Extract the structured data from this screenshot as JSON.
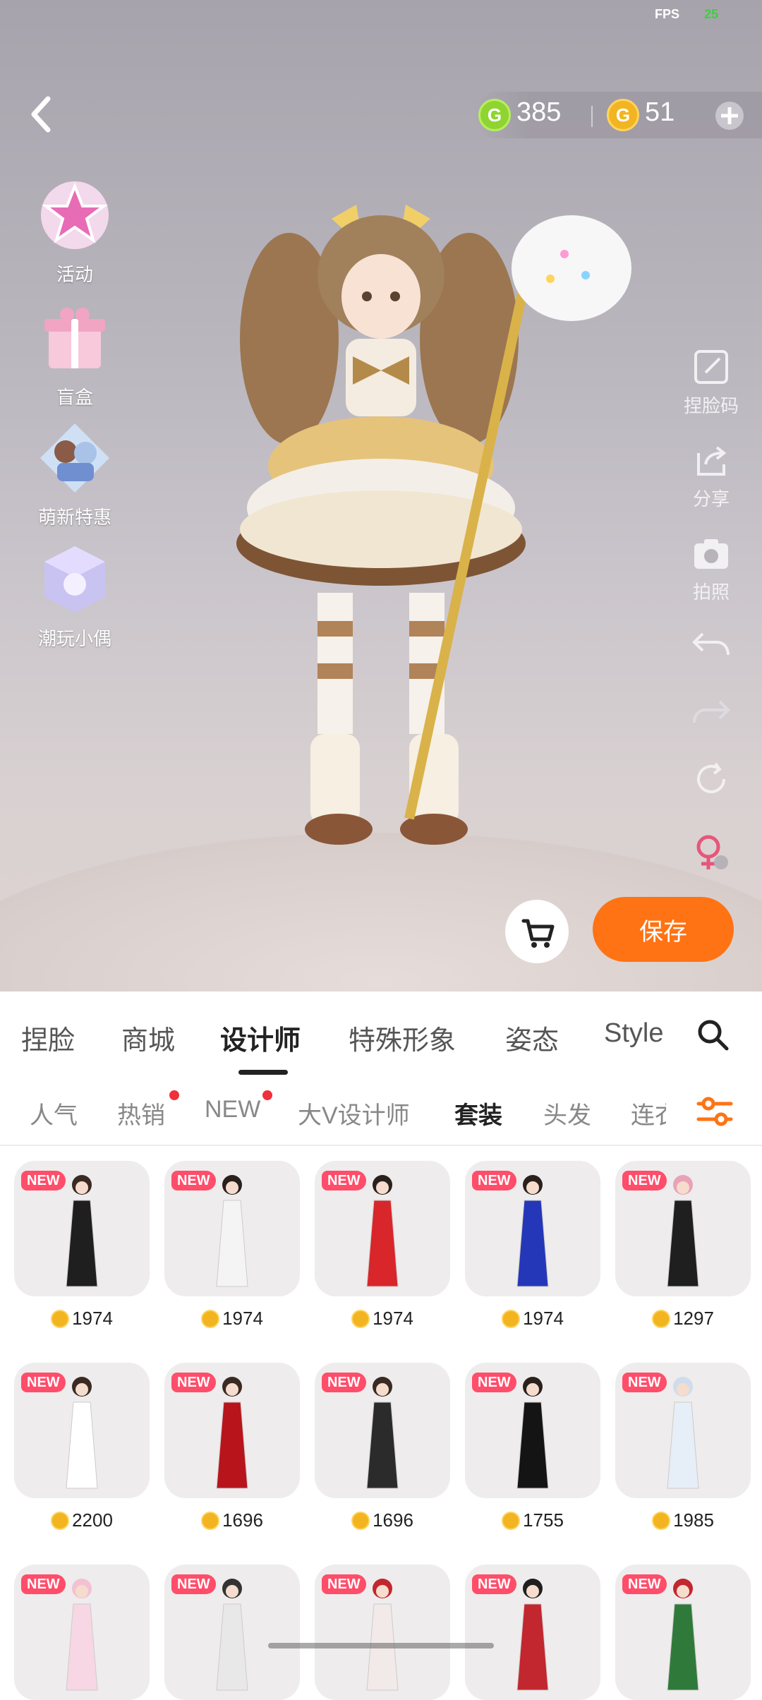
{
  "status": {
    "fps_label": "FPS",
    "fps_value": "25"
  },
  "currency": {
    "green": "385",
    "gold": "51"
  },
  "left_menu": [
    {
      "label": "活动",
      "icon": "star-badge-icon"
    },
    {
      "label": "盲盒",
      "icon": "gift-box-icon"
    },
    {
      "label": "萌新特惠",
      "icon": "character-pack-icon"
    },
    {
      "label": "潮玩小偶",
      "icon": "toy-cube-icon"
    }
  ],
  "right_tools": [
    {
      "label": "捏脸码",
      "icon": "face-code-icon"
    },
    {
      "label": "分享",
      "icon": "share-icon"
    },
    {
      "label": "拍照",
      "icon": "camera-icon"
    },
    {
      "label": "",
      "icon": "undo-icon"
    },
    {
      "label": "",
      "icon": "redo-icon"
    },
    {
      "label": "",
      "icon": "reset-icon"
    },
    {
      "label": "",
      "icon": "gender-switch-icon"
    }
  ],
  "actions": {
    "save": "保存"
  },
  "main_tabs": [
    {
      "label": "捏脸"
    },
    {
      "label": "商城"
    },
    {
      "label": "设计师",
      "active": true
    },
    {
      "label": "特殊形象"
    },
    {
      "label": "姿态"
    },
    {
      "label": "Style"
    }
  ],
  "sub_tabs": [
    {
      "label": "人气"
    },
    {
      "label": "热销",
      "dot": true
    },
    {
      "label": "NEW",
      "dot": true
    },
    {
      "label": "大V设计师"
    },
    {
      "label": "套装",
      "active": true
    },
    {
      "label": "头发"
    },
    {
      "label": "连衣"
    }
  ],
  "badge_text": "NEW",
  "items": [
    {
      "price": "1974",
      "outfit": "black sequin gown"
    },
    {
      "price": "1974",
      "outfit": "white gown"
    },
    {
      "price": "1974",
      "outfit": "red sequin gown"
    },
    {
      "price": "1974",
      "outfit": "blue sequin gown"
    },
    {
      "price": "1297",
      "outfit": "pink hair black top"
    },
    {
      "price": "2200",
      "outfit": "wedding dress scene"
    },
    {
      "price": "1696",
      "outfit": "red mermaid gown"
    },
    {
      "price": "1696",
      "outfit": "black mermaid gown"
    },
    {
      "price": "1755",
      "outfit": "black mini dress cat ears"
    },
    {
      "price": "1985",
      "outfit": "white fluffy outfit"
    },
    {
      "price": "",
      "outfit": "pink lolita"
    },
    {
      "price": "",
      "outfit": "black white lolita"
    },
    {
      "price": "",
      "outfit": "red white lolita"
    },
    {
      "price": "",
      "outfit": "red white dress"
    },
    {
      "price": "",
      "outfit": "christmas dress"
    }
  ],
  "colors": {
    "accent": "#ff7314",
    "badge": "#ff4d6a",
    "coin_gold": "#f2b421",
    "coin_green": "#8fd431"
  }
}
